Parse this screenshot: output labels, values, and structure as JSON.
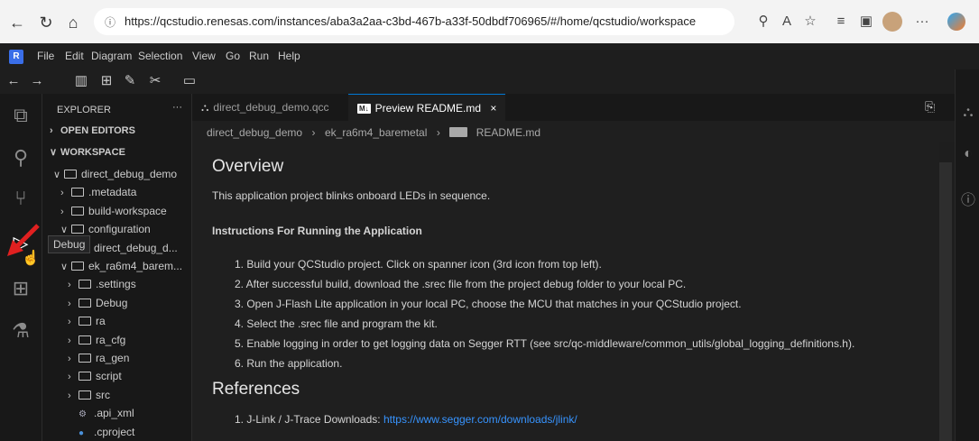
{
  "browser": {
    "url": "https://qcstudio.renesas.com/instances/aba3a2aa-c3bd-467b-a33f-50dbdf706965/#/home/qcstudio/workspace",
    "back_icon": "arrow-left-icon",
    "refresh_icon": "refresh-icon",
    "home_icon": "home-icon"
  },
  "app": {
    "logo_text": "R",
    "menu": [
      "File",
      "Edit",
      "Diagram",
      "Selection",
      "View",
      "Go",
      "Run",
      "Help"
    ]
  },
  "sidebar": {
    "title": "EXPLORER",
    "more": "···",
    "open_editors": "OPEN EDITORS",
    "workspace": "WORKSPACE",
    "tree": [
      {
        "label": "direct_debug_demo",
        "chev": "∨",
        "kind": "folder",
        "indent": 0
      },
      {
        "label": ".metadata",
        "chev": "›",
        "kind": "folder",
        "indent": 1
      },
      {
        "label": "build-workspace",
        "chev": "›",
        "kind": "folder",
        "indent": 1
      },
      {
        "label": "configuration",
        "chev": "∨",
        "kind": "folder",
        "indent": 1
      },
      {
        "label": "direct_debug_d...",
        "chev": "",
        "kind": "file",
        "indent": 2
      },
      {
        "label": "ek_ra6m4_barem...",
        "chev": "∨",
        "kind": "folder",
        "indent": 1
      },
      {
        "label": ".settings",
        "chev": "›",
        "kind": "folder",
        "indent": 2
      },
      {
        "label": "Debug",
        "chev": "›",
        "kind": "folder",
        "indent": 2
      },
      {
        "label": "ra",
        "chev": "›",
        "kind": "folder",
        "indent": 2
      },
      {
        "label": "ra_cfg",
        "chev": "›",
        "kind": "folder",
        "indent": 2
      },
      {
        "label": "ra_gen",
        "chev": "›",
        "kind": "folder",
        "indent": 2
      },
      {
        "label": "script",
        "chev": "›",
        "kind": "folder",
        "indent": 2
      },
      {
        "label": "src",
        "chev": "›",
        "kind": "folder",
        "indent": 2
      },
      {
        "label": ".api_xml",
        "chev": "",
        "kind": "gear",
        "indent": 2
      },
      {
        "label": ".cproject",
        "chev": "",
        "kind": "dot",
        "indent": 2
      }
    ]
  },
  "tooltip": "Debug",
  "tabs": [
    {
      "label": "direct_debug_demo.qcc",
      "active": false
    },
    {
      "label": "Preview README.md",
      "active": true,
      "close": "×"
    }
  ],
  "breadcrumb": [
    "direct_debug_demo",
    "ek_ra6m4_baremetal",
    "README.md"
  ],
  "readme": {
    "h_overview": "Overview",
    "intro": "This application project blinks onboard LEDs in sequence.",
    "instructions_heading": "Instructions For Running the Application",
    "steps": [
      "1. Build your QCStudio project. Click on spanner icon (3rd icon from top left).",
      "2. After successful build, download the .srec file from the project debug folder to your local PC.",
      "3. Open J-Flash Lite application in your local PC, choose the MCU that matches in your QCStudio project.",
      "4. Select the .srec file and program the kit.",
      "5. Enable logging in order to get logging data on Segger RTT (see src/qc-middleware/common_utils/global_logging_definitions.h).",
      "6. Run the application."
    ],
    "h_references": "References",
    "ref_prefix": "1. J-Link / J-Trace Downloads: ",
    "ref_link": "https://www.segger.com/downloads/jlink/"
  },
  "colors": {
    "accent": "#0078d4",
    "link": "#3794ff",
    "annotation_arrow": "#e02020"
  }
}
